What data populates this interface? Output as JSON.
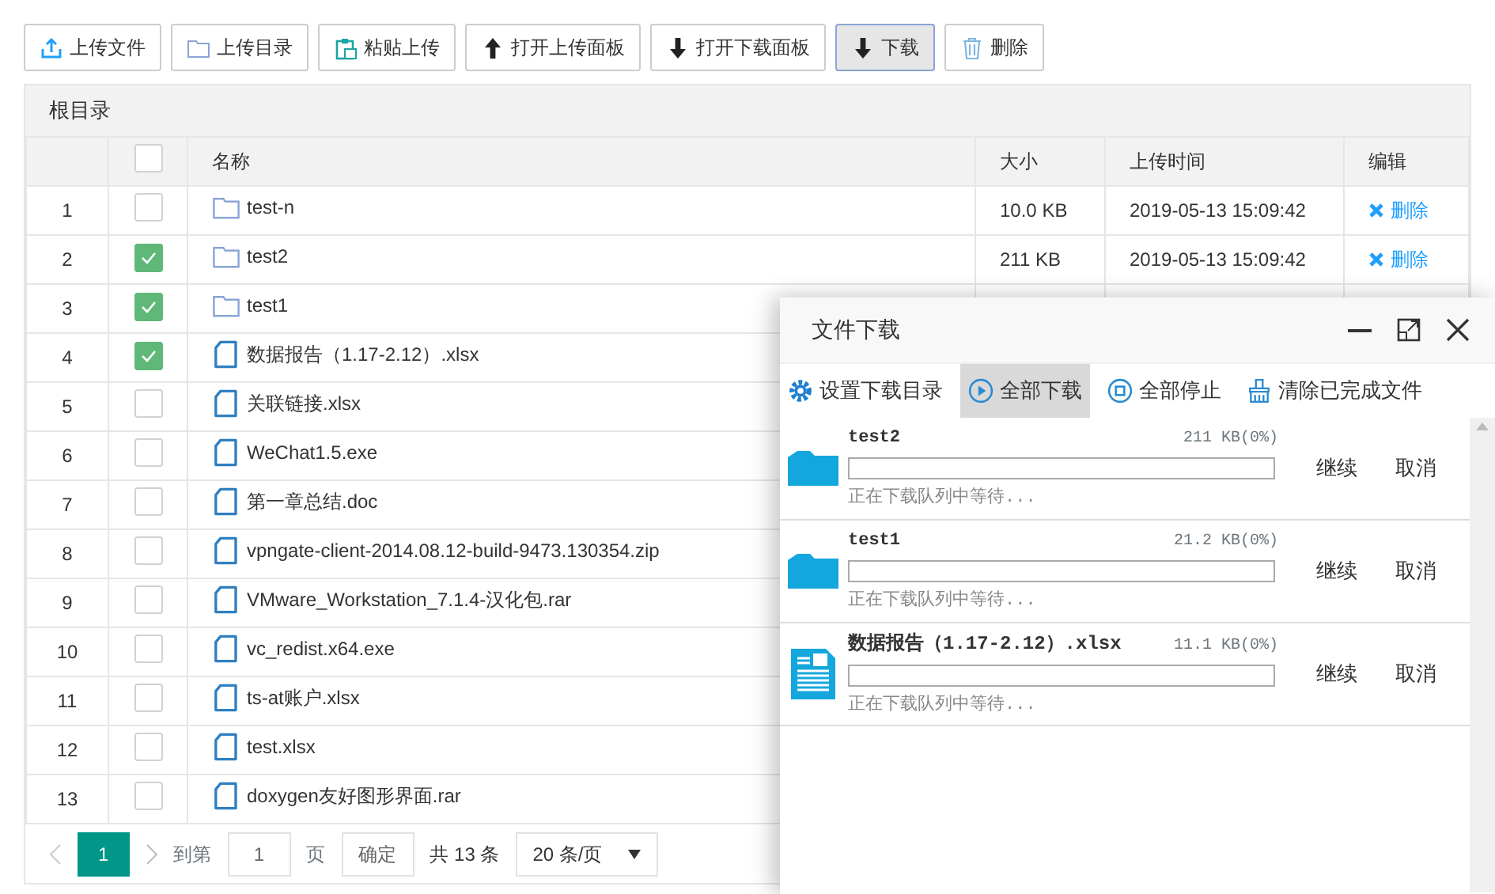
{
  "toolbar": [
    {
      "kind": "upload",
      "label": "上传文件",
      "selected": false
    },
    {
      "kind": "folder",
      "label": "上传目录",
      "selected": false
    },
    {
      "kind": "paste",
      "label": "粘贴上传",
      "selected": false
    },
    {
      "kind": "up",
      "label": "打开上传面板",
      "selected": false
    },
    {
      "kind": "down",
      "label": "打开下载面板",
      "selected": false
    },
    {
      "kind": "down",
      "label": "下载",
      "selected": true
    },
    {
      "kind": "trash",
      "label": "删除",
      "selected": false
    }
  ],
  "breadcrumb": "根目录",
  "table": {
    "columns": [
      "名称",
      "大小",
      "上传时间",
      "编辑"
    ],
    "all_checked": false,
    "rows": [
      {
        "index": "1",
        "checked": false,
        "kind": "folder",
        "name": "test-n",
        "size": "10.0 KB",
        "time": "2019-05-13 15:09:42",
        "action": "删除"
      },
      {
        "index": "2",
        "checked": true,
        "kind": "folder",
        "name": "test2",
        "size": "211 KB",
        "time": "2019-05-13 15:09:42",
        "action": "删除"
      },
      {
        "index": "3",
        "checked": true,
        "kind": "folder",
        "name": "test1"
      },
      {
        "index": "4",
        "checked": true,
        "kind": "file",
        "name": "数据报告（1.17-2.12）.xlsx"
      },
      {
        "index": "5",
        "checked": false,
        "kind": "file",
        "name": "关联链接.xlsx"
      },
      {
        "index": "6",
        "checked": false,
        "kind": "file",
        "name": "WeChat1.5.exe"
      },
      {
        "index": "7",
        "checked": false,
        "kind": "file",
        "name": "第一章总结.doc"
      },
      {
        "index": "8",
        "checked": false,
        "kind": "file",
        "name": "vpngate-client-2014.08.12-build-9473.130354.zip"
      },
      {
        "index": "9",
        "checked": false,
        "kind": "file",
        "name": "VMware_Workstation_7.1.4-汉化包.rar"
      },
      {
        "index": "10",
        "checked": false,
        "kind": "file",
        "name": "vc_redist.x64.exe"
      },
      {
        "index": "11",
        "checked": false,
        "kind": "file",
        "name": "ts-at账户.xlsx"
      },
      {
        "index": "12",
        "checked": false,
        "kind": "file",
        "name": "test.xlsx"
      },
      {
        "index": "13",
        "checked": false,
        "kind": "file",
        "name": "doxygen友好图形界面.rar"
      }
    ]
  },
  "pagination": {
    "pages": [
      {
        "label": "1",
        "selected": true
      }
    ],
    "goto_label": "到第",
    "goto_value": "1",
    "page_unit": "页",
    "confirm": "确定",
    "total": "共 13 条",
    "page_size": "20 条/页"
  },
  "download_dialog": {
    "title": "文件下载",
    "toolbar": [
      {
        "kind": "gear",
        "label": "设置下载目录",
        "selected": false
      },
      {
        "kind": "play",
        "label": "全部下载",
        "selected": true
      },
      {
        "kind": "stop",
        "label": "全部停止",
        "selected": false
      },
      {
        "kind": "clear",
        "label": "清除已完成文件",
        "selected": false
      }
    ],
    "items": [
      {
        "kind": "folder",
        "name": "test2",
        "size": "211 KB(0%)",
        "level": 0,
        "status": "正在下载队列中等待...",
        "resume": "继续",
        "cancel": "取消"
      },
      {
        "kind": "folder",
        "name": "test1",
        "size": "21.2 KB(0%)",
        "level": 0,
        "status": "正在下载队列中等待...",
        "resume": "继续",
        "cancel": "取消"
      },
      {
        "kind": "file",
        "name": "数据报告（1.17-2.12）.xlsx",
        "size": "11.1 KB(0%)",
        "level": 0,
        "status": "正在下载队列中等待...",
        "resume": "继续",
        "cancel": "取消"
      }
    ]
  }
}
